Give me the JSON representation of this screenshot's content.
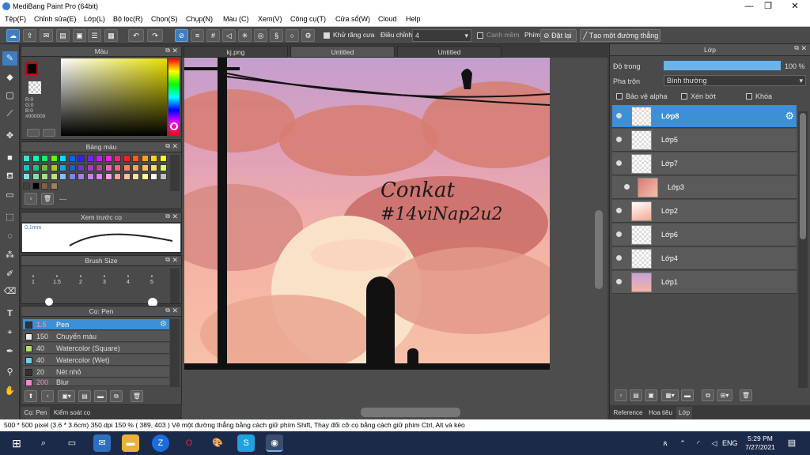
{
  "window": {
    "title": "MediBang Paint Pro (64bit)",
    "minimize": "—",
    "maximize": "❐",
    "close": "✕"
  },
  "menu": [
    "Tệp(F)",
    "Chỉnh sửa(E)",
    "Lớp(L)",
    "Bộ lọc(R)",
    "Chọn(S)",
    "Chụp(N)",
    "Màu (C)",
    "Xem(V)",
    "Công cụ(T)",
    "Cửa sổ(W)",
    "Cloud",
    "Help"
  ],
  "toolbar": {
    "antialias_label": "Khử răng cưa",
    "adjust_label": "Điều chỉnh",
    "adjust_value": "4",
    "smooth_label": "Canh mềm",
    "phim_label": "Phím",
    "reset_label": "Đặt lại",
    "line_label": "Tạo một đường thẳng"
  },
  "color_panel": {
    "title": "Màu",
    "r": "R:0",
    "g": "G:0",
    "b": "B:0",
    "hex": "#000000"
  },
  "palette_panel": {
    "title": "Bảng màu",
    "dash": "---"
  },
  "preview_panel": {
    "title": "Xem trước cọ",
    "size": "0.1mm"
  },
  "brushsize_panel": {
    "title": "Brush Size",
    "sizes": [
      "1",
      "1.5",
      "2",
      "3",
      "4",
      "5"
    ]
  },
  "brush_panel": {
    "title": "Cọ: Pen",
    "items": [
      {
        "size": "1.5",
        "name": "Pen",
        "color": "#ffffff"
      },
      {
        "size": "150",
        "name": "Chuyển màu",
        "color": "#ffffff"
      },
      {
        "size": "40",
        "name": "Watercolor (Square)",
        "color": "#b7e06a"
      },
      {
        "size": "40",
        "name": "Watercolor (Wet)",
        "color": "#6ad0f0"
      },
      {
        "size": "20",
        "name": "Nét nhỏ",
        "color": "#333333"
      },
      {
        "size": "200",
        "name": "Blur",
        "color": "#f08ad0"
      }
    ]
  },
  "left_tabs": [
    "Cọ: Pen",
    "Kiểm soát cọ"
  ],
  "canvas_tabs": [
    "kj.png",
    "Untitled",
    "Untitled"
  ],
  "artwork_text": {
    "line1": "Conkat",
    "line2": "#14viNap2u2"
  },
  "layer_panel": {
    "title": "Lớp",
    "opacity_label": "Độ trong",
    "opacity_value": "100 %",
    "opacity_fraction": 1.0,
    "blend_label": "Pha trộn",
    "blend_value": "Bình thường",
    "protect_alpha": "Bảo vệ alpha",
    "clipping": "Xén bớt",
    "lock": "Khóa",
    "layers": [
      "Lớp8",
      "Lớp5",
      "Lớp7",
      "Lớp3",
      "Lớp2",
      "Lớp6",
      "Lớp4",
      "Lớp1"
    ]
  },
  "right_tabs": [
    "Reference",
    "Hoa tiêu",
    "Lớp"
  ],
  "status": {
    "text": "500 * 500 pixel  (3.6 * 3.6cm)   350 dpi   150 %   ( 389, 403 )   Vẽ một đường thẳng bằng cách giữ phím Shift, Thay đổi cỡ cọ bằng cách giữ phím Ctrl, Alt và kéo"
  },
  "taskbar": {
    "lang": "ENG",
    "time": "5:29 PM",
    "date": "7/27/2021"
  }
}
